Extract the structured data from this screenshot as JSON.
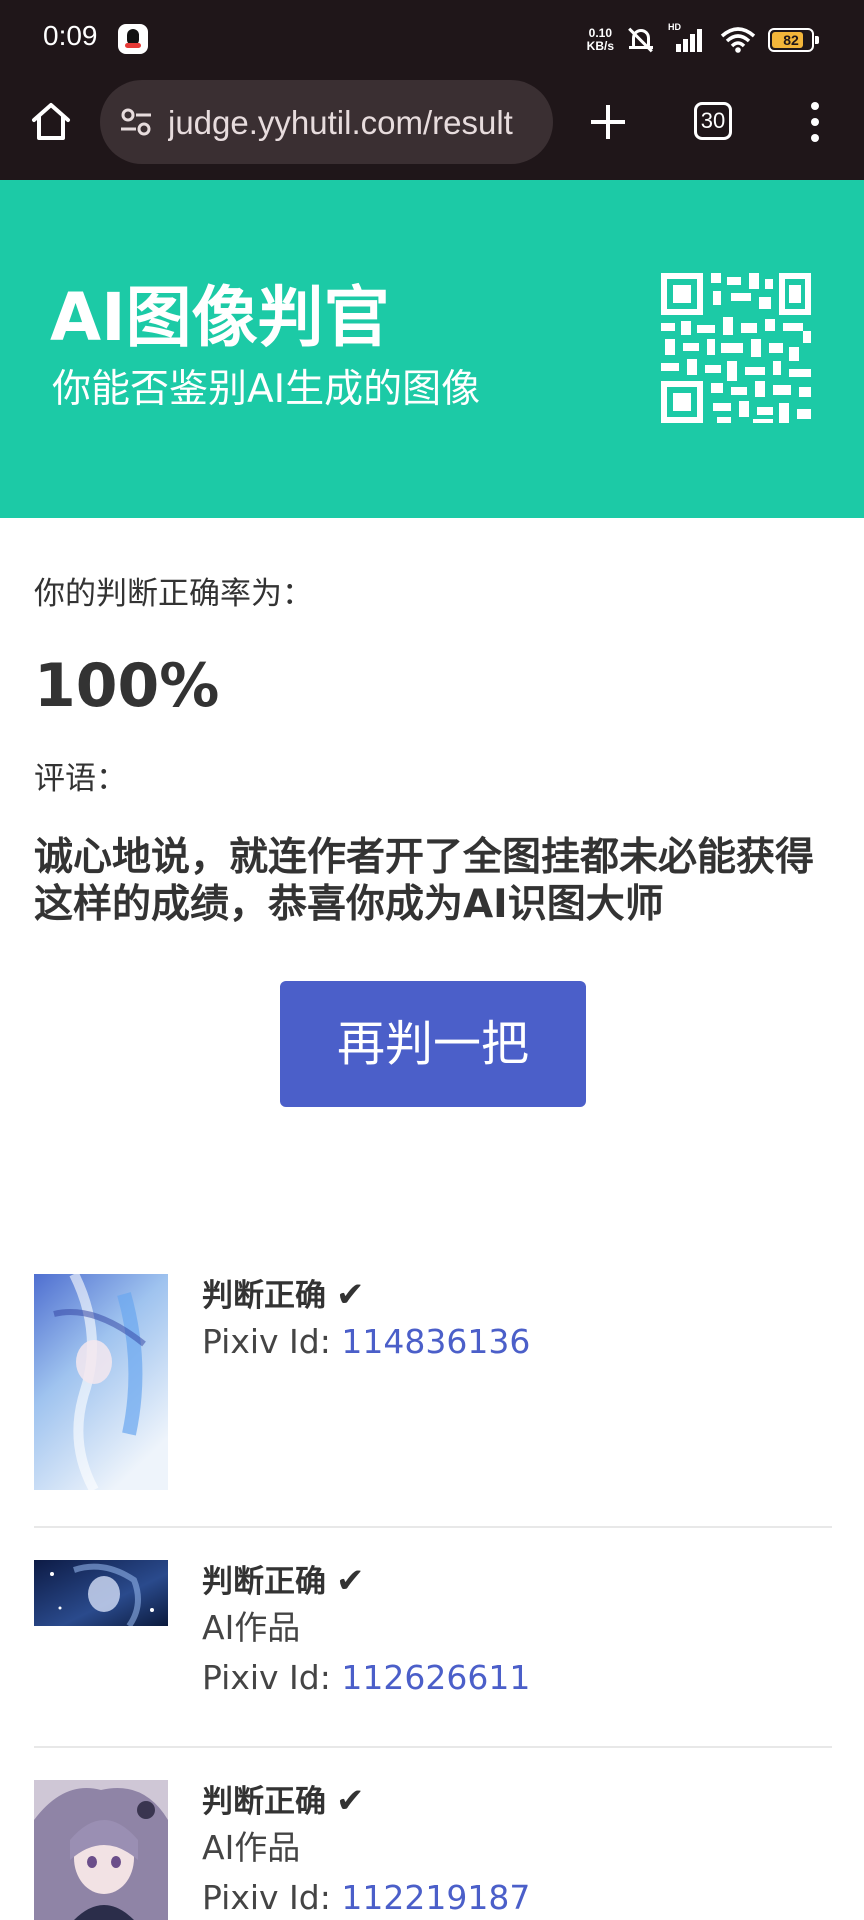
{
  "status_bar": {
    "time": "0:09",
    "net_speed_value": "0.10",
    "net_speed_unit": "KB/s",
    "battery_level": "82",
    "battery_fraction": 0.82,
    "signal_tag": "HD"
  },
  "browser": {
    "url": "judge.yyhutil.com/result",
    "tab_count": "30"
  },
  "hero": {
    "title": "AI图像判官",
    "subtitle": "你能否鉴别AI生成的图像",
    "background_color": "#1ccaa6"
  },
  "result": {
    "accuracy_label": "你的判断正确率为：",
    "accuracy_value": "100%",
    "comment_label": "评语：",
    "comment": "诚心地说，就连作者开了全图挂都未必能获得这样的成绩，恭喜你成为AI识图大师",
    "retry_button": "再判一把",
    "button_color": "#4b5fc9"
  },
  "items": [
    {
      "verdict": "判断正确",
      "check": "✔",
      "pixiv_label": "Pixiv Id: ",
      "pixiv_id": "114836136"
    },
    {
      "verdict": "判断正确",
      "check": "✔",
      "type": "AI作品",
      "pixiv_label": "Pixiv Id: ",
      "pixiv_id": "112626611"
    },
    {
      "verdict": "判断正确",
      "check": "✔",
      "type": "AI作品",
      "pixiv_label": "Pixiv Id: ",
      "pixiv_id": "112219187"
    }
  ]
}
